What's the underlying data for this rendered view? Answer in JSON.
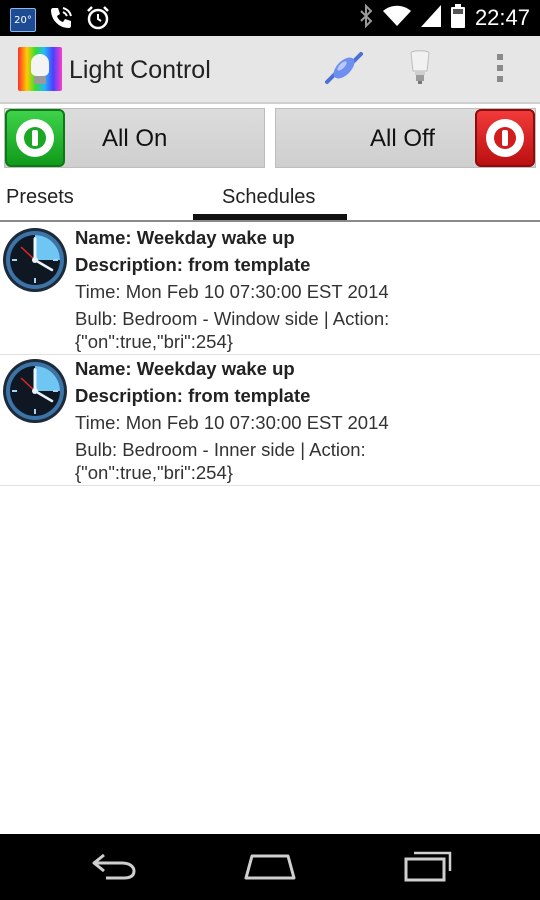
{
  "status_bar": {
    "temperature": "20°",
    "time": "22:47"
  },
  "app": {
    "title": "Light Control"
  },
  "icons": {
    "connection": "bridge-connection-icon",
    "bulb": "bulb-icon",
    "overflow": "overflow-menu-icon",
    "back": "back-icon",
    "home": "home-icon",
    "recents": "recent-apps-icon"
  },
  "controls": {
    "all_on": "All On",
    "all_off": "All Off"
  },
  "tabs": [
    {
      "label": "Presets",
      "selected": false
    },
    {
      "label": "Schedules",
      "selected": true
    }
  ],
  "schedules": [
    {
      "name": "Name: Weekday wake up",
      "description": "Description: from template",
      "time": "Time: Mon Feb 10 07:30:00 EST 2014",
      "bulb_action": "Bulb: Bedroom - Window side | Action:",
      "action_value": "{\"on\":true,\"bri\":254}"
    },
    {
      "name": "Name: Weekday wake up",
      "description": "Description: from template",
      "time": "Time: Mon Feb 10 07:30:00 EST 2014",
      "bulb_action": "Bulb: Bedroom - Inner side | Action:",
      "action_value": "{\"on\":true,\"bri\":254}"
    }
  ],
  "colors": {
    "on_green": "#1aa824",
    "off_red": "#d11d1d",
    "action_bar": "#e6e6e6"
  }
}
